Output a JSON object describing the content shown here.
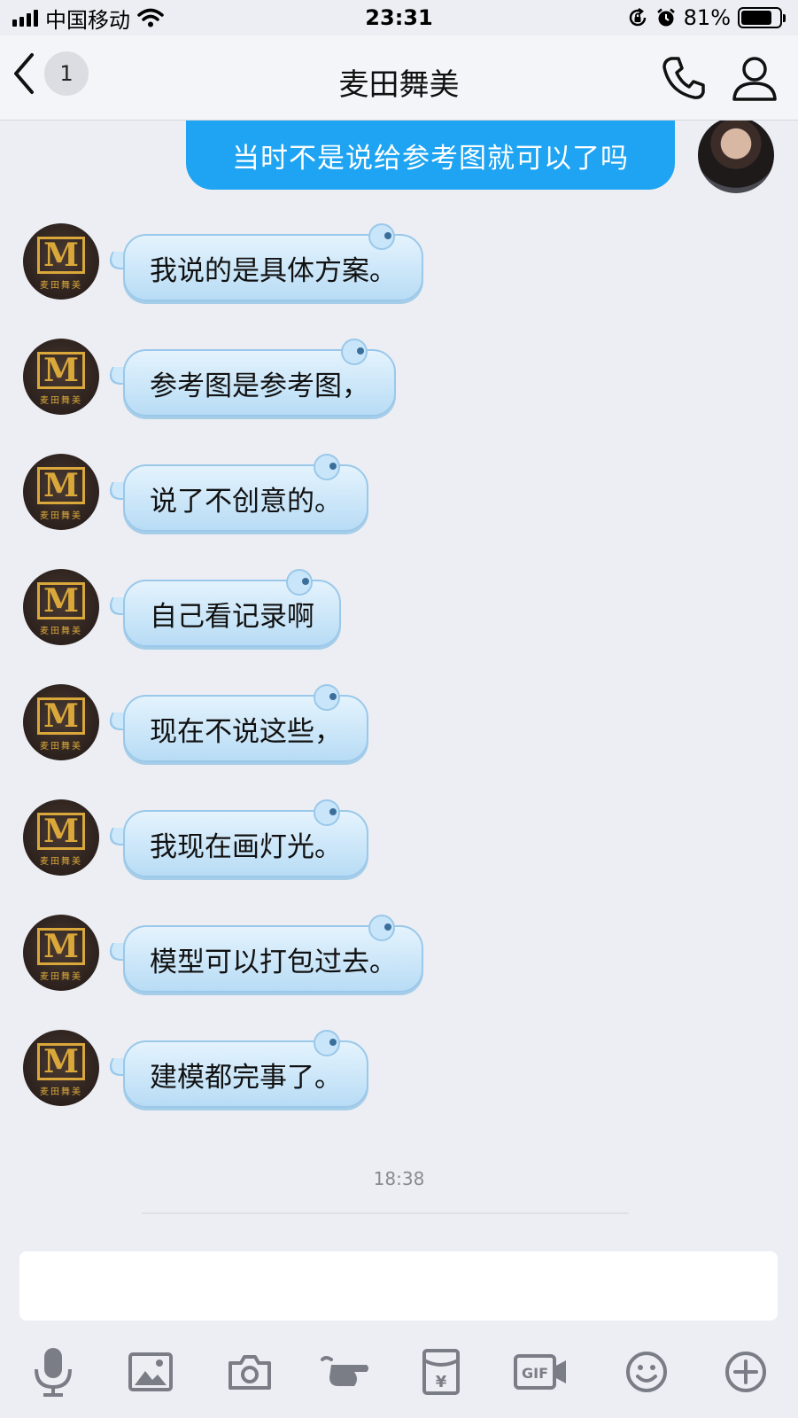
{
  "status_bar": {
    "carrier": "中国移动",
    "time": "23:31",
    "battery_percent": "81%",
    "battery_level": 0.81,
    "icons": [
      "signal-icon",
      "wifi-icon",
      "orientation-lock-icon",
      "alarm-icon",
      "battery-icon"
    ]
  },
  "nav": {
    "unread_count": "1",
    "title": "麦田舞美",
    "icons": [
      "back-chevron-icon",
      "phone-icon",
      "profile-icon"
    ]
  },
  "messages": [
    {
      "sender": "me",
      "text": "当时不是说给参考图就可以了吗"
    },
    {
      "sender": "contact",
      "text": "我说的是具体方案。"
    },
    {
      "sender": "contact",
      "text": "参考图是参考图，"
    },
    {
      "sender": "contact",
      "text": "说了不创意的。"
    },
    {
      "sender": "contact",
      "text": "自己看记录啊"
    },
    {
      "sender": "contact",
      "text": "现在不说这些，"
    },
    {
      "sender": "contact",
      "text": "我现在画灯光。"
    },
    {
      "sender": "contact",
      "text": "模型可以打包过去。"
    },
    {
      "sender": "contact",
      "text": "建模都完事了。"
    }
  ],
  "contact_avatar": {
    "logo_letter": "M",
    "logo_caption": "麦田舞美"
  },
  "timestamp": "18:38",
  "input": {
    "value": "",
    "placeholder": ""
  },
  "toolbar": {
    "gif_label": "GIF",
    "red_packet_symbol": "¥",
    "icons": [
      "microphone-icon",
      "image-icon",
      "camera-icon",
      "poke-icon",
      "red-packet-icon",
      "gif-icon",
      "emoji-icon",
      "plus-icon"
    ]
  },
  "colors": {
    "background": "#eceef3",
    "outgoing_bubble": "#1ea4f2",
    "incoming_bubble": "#c9e5f9",
    "icon_gray": "#7a7d86"
  }
}
